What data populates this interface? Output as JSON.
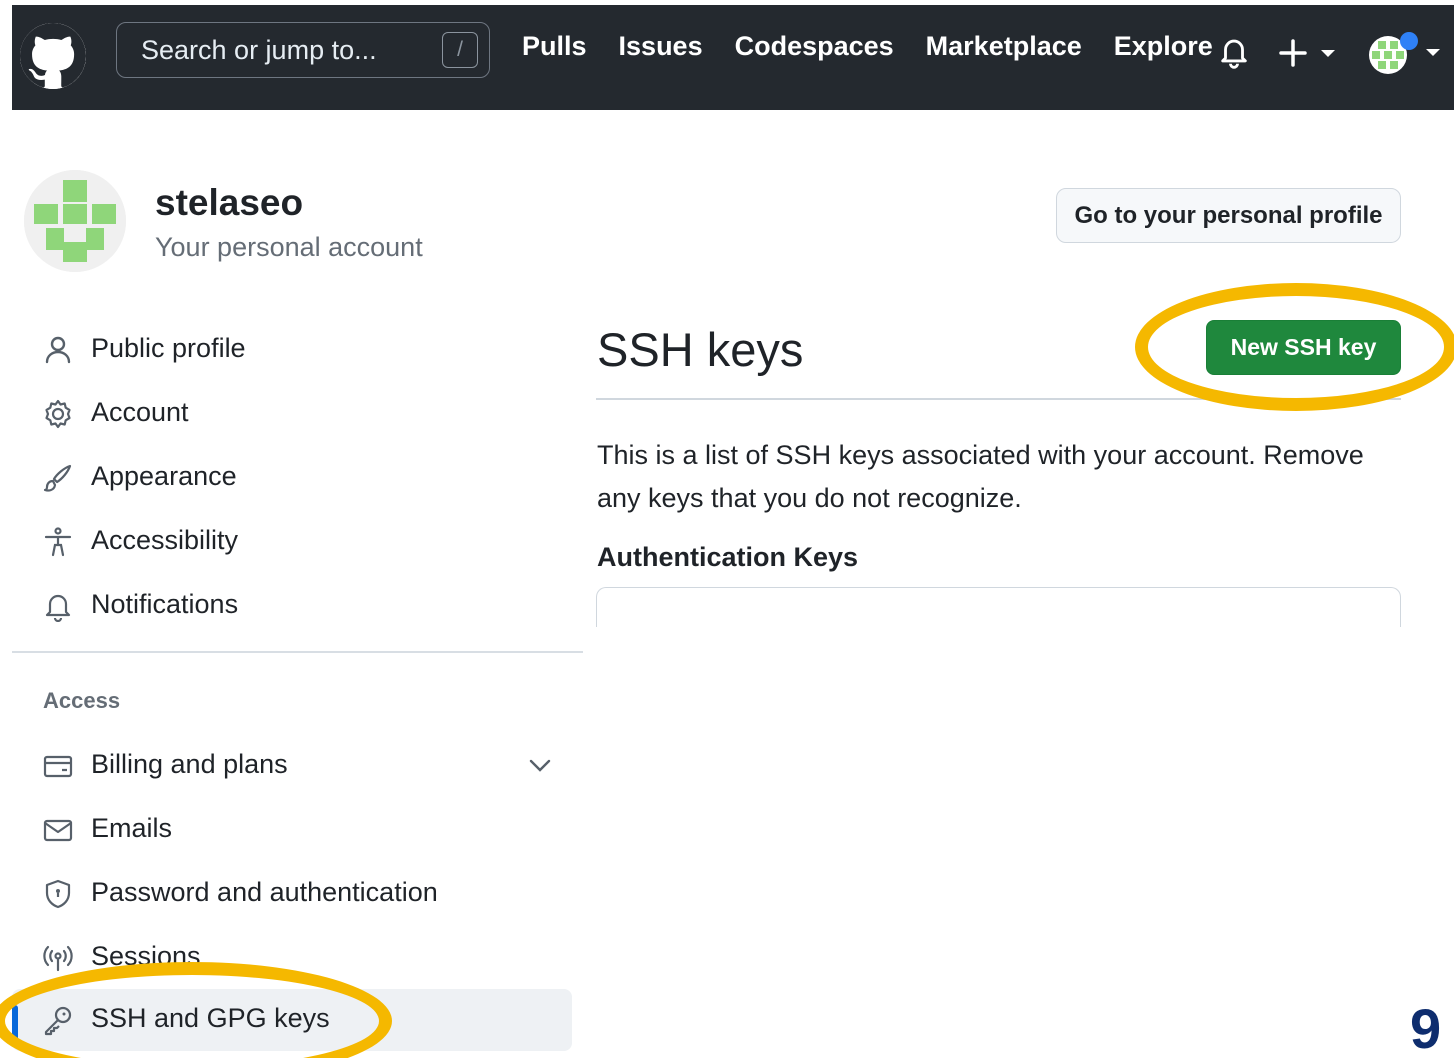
{
  "topnav": {
    "search_placeholder": "Search or jump to...",
    "search_shortcut": "/",
    "links": [
      "Pulls",
      "Issues",
      "Codespaces",
      "Marketplace",
      "Explore"
    ],
    "plus_label": "+"
  },
  "profile": {
    "username": "stelaseo",
    "subtitle": "Your personal account",
    "profile_button": "Go to your personal profile"
  },
  "sidebar": {
    "items": [
      {
        "label": "Public profile",
        "icon": "person-icon"
      },
      {
        "label": "Account",
        "icon": "gear-icon"
      },
      {
        "label": "Appearance",
        "icon": "paintbrush-icon"
      },
      {
        "label": "Accessibility",
        "icon": "accessibility-icon"
      },
      {
        "label": "Notifications",
        "icon": "bell-icon"
      }
    ],
    "access_heading": "Access",
    "access_items": [
      {
        "label": "Billing and plans",
        "icon": "credit-card-icon"
      },
      {
        "label": "Emails",
        "icon": "mail-icon"
      },
      {
        "label": "Password and authentication",
        "icon": "shield-icon"
      },
      {
        "label": "Sessions",
        "icon": "broadcast-icon"
      },
      {
        "label": "SSH and GPG keys",
        "icon": "key-icon"
      }
    ]
  },
  "main": {
    "title": "SSH keys",
    "new_key_button": "New SSH key",
    "description": "This is a list of SSH keys associated with your account. Remove any keys that you do not recognize.",
    "auth_heading": "Authentication Keys"
  },
  "annotation": {
    "step_number": "9",
    "highlight_color": "#f5b800"
  },
  "colors": {
    "header_bg": "#24292f",
    "primary_button": "#1f883d",
    "active_accent": "#0969da"
  }
}
